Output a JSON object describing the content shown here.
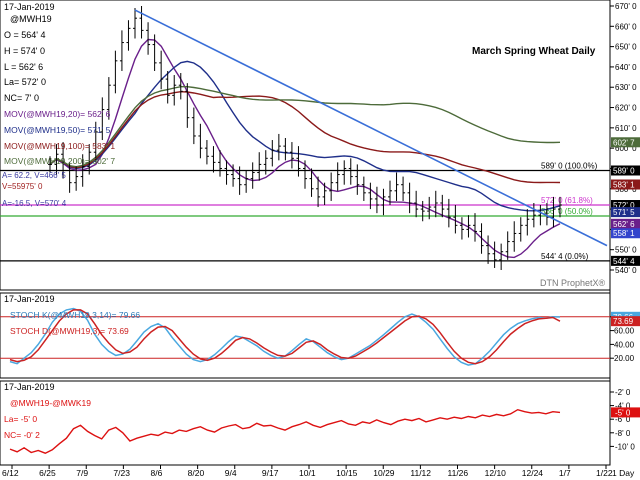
{
  "chart_data": [
    {
      "type": "candlestick",
      "panel": "price",
      "date": "17-Jan-2019",
      "title": "March Spring Wheat Daily",
      "ohlc_readout": [
        "@MWH19",
        "O = 564' 4",
        "H = 574' 0",
        "L = 562' 6",
        "La= 572' 0",
        "NC= 7' 0"
      ],
      "moving_averages": [
        {
          "label": "MOV(@MWH19,20)= 562' 6",
          "value": 562.75,
          "color": "#6a1f8a",
          "tag": "562' 6"
        },
        {
          "label": "MOV(@MWH19,50)= 571' 5",
          "value": 571.6,
          "color": "#1f2f8a",
          "tag": "571' 5"
        },
        {
          "label": "MOV(@MWH19,100)= 583' 1",
          "value": 583.1,
          "color": "#8b1a1a",
          "tag": "583' 1"
        },
        {
          "label": "MOV(@MWH19,200)= 602' 7",
          "value": 602.9,
          "color": "#4d6b3a",
          "tag": "602' 7"
        }
      ],
      "volume_labels": [
        "A= 62.2, V=466' 5",
        "V=55975' 0",
        "A=-16.5, V=570' 4"
      ],
      "retracement_levels": [
        {
          "label": "589' 0 (100.0%)",
          "value": 589.0,
          "color": "#000000"
        },
        {
          "label": "572' 0 (61.8%)",
          "value": 572.0,
          "color": "#cc33cc"
        },
        {
          "label": "566' 0 (50.0%)",
          "value": 566.6,
          "color": "#33aa33"
        },
        {
          "label": "544' 4 (0.0%)",
          "value": 544.5,
          "color": "#000000"
        }
      ],
      "last_price_tag": "572' 0",
      "extra_tags": [
        "589' 0",
        "558' 1",
        "544' 4"
      ],
      "ylim": [
        540,
        670
      ],
      "yticks": [
        "540' 0",
        "550' 0",
        "560' 0",
        "570' 0",
        "580' 0",
        "590' 0",
        "600' 0",
        "610' 0",
        "620' 0",
        "630' 0",
        "640' 0",
        "650' 0",
        "660' 0",
        "670' 0"
      ],
      "watermark": "DTN ProphetX®",
      "series_close": [
        592,
        597,
        589,
        583,
        586,
        591,
        598,
        608,
        619,
        631,
        643,
        652,
        659,
        664,
        658,
        651,
        642,
        634,
        626,
        631,
        628,
        615,
        606,
        600,
        596,
        593,
        590,
        587,
        585,
        582,
        585,
        588,
        592,
        595,
        599,
        601,
        598,
        595,
        590,
        585,
        580,
        576,
        579,
        583,
        587,
        590,
        586,
        582,
        578,
        575,
        572,
        576,
        579,
        582,
        578,
        573,
        570,
        569,
        571,
        573,
        570,
        566,
        562,
        560,
        562,
        559,
        552,
        548,
        545,
        549,
        554,
        558,
        562,
        565,
        567,
        568,
        566,
        570,
        572
      ]
    },
    {
      "type": "line",
      "panel": "stochastic",
      "date": "17-Jan-2019",
      "legend": [
        "STOCH K(@MWH19,3,14)= 79.66",
        "STOCH D(@MWH19,3)= 73.69"
      ],
      "series": [
        {
          "name": "STOCH K(@MWH19,3,14)",
          "color": "#4aa8e0",
          "tag": "79.66",
          "values": [
            15,
            12,
            20,
            28,
            40,
            55,
            72,
            84,
            90,
            92,
            88,
            75,
            55,
            40,
            30,
            24,
            26,
            33,
            45,
            58,
            66,
            70,
            64,
            50,
            38,
            26,
            18,
            15,
            18,
            25,
            34,
            44,
            52,
            50,
            44,
            38,
            30,
            24,
            20,
            23,
            31,
            40,
            48,
            44,
            36,
            28,
            22,
            18,
            20,
            26,
            32,
            38,
            46,
            54,
            63,
            72,
            80,
            84,
            80,
            72,
            62,
            48,
            34,
            22,
            14,
            10,
            12,
            20,
            30,
            42,
            54,
            63,
            70,
            74,
            77,
            79,
            78,
            80,
            79.66
          ]
        },
        {
          "name": "STOCH D(@MWH19,3)",
          "color": "#cc2222",
          "tag": "73.69",
          "values": [
            18,
            15,
            17,
            22,
            32,
            46,
            60,
            74,
            84,
            90,
            90,
            84,
            70,
            54,
            42,
            32,
            27,
            29,
            36,
            48,
            58,
            65,
            66,
            60,
            48,
            36,
            26,
            19,
            17,
            20,
            27,
            36,
            46,
            50,
            48,
            42,
            35,
            29,
            24,
            23,
            27,
            35,
            43,
            45,
            40,
            32,
            26,
            21,
            20,
            23,
            29,
            35,
            42,
            50,
            58,
            66,
            74,
            80,
            81,
            77,
            69,
            57,
            43,
            30,
            20,
            14,
            12,
            15,
            22,
            32,
            44,
            55,
            63,
            70,
            74,
            77,
            78,
            79,
            73.69
          ]
        }
      ],
      "ylim": [
        0,
        100
      ],
      "reference_lines": [
        80,
        20
      ],
      "yticks": [
        "20.00",
        "40.00",
        "60.00",
        "80.00"
      ]
    },
    {
      "type": "line",
      "panel": "spread",
      "date": "17-Jan-2019",
      "legend": [
        "@MWH19-@MWK19",
        "La= -5' 0",
        "NC= -0' 2"
      ],
      "series": [
        {
          "name": "@MWH19-@MWK19",
          "color": "#dd1111",
          "tag": "-5' 0",
          "values": [
            -10.4,
            -10.8,
            -10.2,
            -10.9,
            -10.6,
            -11.0,
            -10.5,
            -9.6,
            -8.8,
            -7.4,
            -6.9,
            -7.8,
            -8.4,
            -8.9,
            -7.6,
            -7.2,
            -8.0,
            -9.2,
            -8.8,
            -8.5,
            -8.2,
            -8.4,
            -7.9,
            -8.1,
            -7.6,
            -7.8,
            -7.4,
            -7.1,
            -7.6,
            -7.9,
            -7.3,
            -7.0,
            -6.8,
            -7.4,
            -7.2,
            -6.6,
            -7.0,
            -6.9,
            -7.3,
            -7.6,
            -7.1,
            -6.8,
            -6.4,
            -6.9,
            -7.2,
            -6.8,
            -6.5,
            -6.2,
            -6.7,
            -6.9,
            -6.4,
            -6.6,
            -6.1,
            -6.5,
            -6.8,
            -6.3,
            -6.0,
            -6.2,
            -5.9,
            -6.4,
            -6.1,
            -5.8,
            -6.0,
            -5.7,
            -5.9,
            -5.6,
            -5.8,
            -5.4,
            -5.6,
            -5.3,
            -5.5,
            -5.2,
            -4.6,
            -4.9,
            -5.1,
            -5.0,
            -5.2,
            -4.9,
            -5.0
          ]
        }
      ],
      "ylim": [
        -12,
        -2
      ],
      "yticks": [
        "-2' 0",
        "-4' 0",
        "-6' 0",
        "-8' 0",
        "-10' 0"
      ]
    }
  ],
  "x_axis": {
    "labels": [
      "6/12",
      "6/25",
      "7/9",
      "7/23",
      "8/6",
      "8/20",
      "9/4",
      "9/17",
      "10/1",
      "10/15",
      "10/29",
      "11/12",
      "11/26",
      "12/10",
      "12/24",
      "1/7",
      "1/22"
    ],
    "interval_label": "1 Day"
  }
}
